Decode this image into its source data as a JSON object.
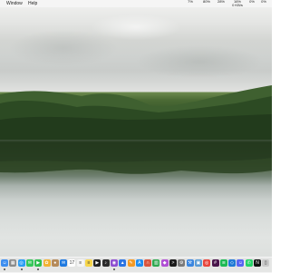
{
  "menubar": {
    "items": [
      "Window",
      "Help"
    ],
    "status": [
      {
        "top": "",
        "bottom": "7%"
      },
      {
        "top": "",
        "bottom": "80%"
      },
      {
        "top": "",
        "bottom": "28%"
      },
      {
        "top": "16%",
        "bottom": "0 KB/s"
      },
      {
        "top": "",
        "bottom": "0%"
      },
      {
        "top": "",
        "bottom": "0%"
      }
    ]
  },
  "desktop": {
    "wallpaper": "lake-reflection"
  },
  "dock": {
    "apps": [
      {
        "name": "finder-icon",
        "color": "#3d8ef0",
        "glyph": "☺"
      },
      {
        "name": "launchpad-icon",
        "color": "#8a8a8a",
        "glyph": "▦"
      },
      {
        "name": "safari-icon",
        "color": "#2a9df4",
        "glyph": "◎"
      },
      {
        "name": "messages-icon",
        "color": "#34c759",
        "glyph": "✉"
      },
      {
        "name": "facetime-icon",
        "color": "#2fbf4f",
        "glyph": "▶"
      },
      {
        "name": "photos-icon",
        "color": "#f2b233",
        "glyph": "✿"
      },
      {
        "name": "contacts-icon",
        "color": "#b58a5a",
        "glyph": "●"
      },
      {
        "name": "mail-icon",
        "color": "#1f7ae0",
        "glyph": "✉"
      },
      {
        "name": "calendar-icon",
        "color": "#ffffff",
        "glyph": "17"
      },
      {
        "name": "reminders-icon",
        "color": "#f5f5f5",
        "glyph": "≡"
      },
      {
        "name": "notes-icon",
        "color": "#f7d64a",
        "glyph": "≡"
      },
      {
        "name": "tv-icon",
        "color": "#222222",
        "glyph": "▶"
      },
      {
        "name": "music-icon",
        "color": "#2c2c2c",
        "glyph": "♪"
      },
      {
        "name": "podcasts-icon",
        "color": "#8e4fd1",
        "glyph": "◉"
      },
      {
        "name": "keynote-icon",
        "color": "#2b74e4",
        "glyph": "▲"
      },
      {
        "name": "pages-icon",
        "color": "#f59a23",
        "glyph": "✎"
      },
      {
        "name": "app-store-icon",
        "color": "#1f8ef1",
        "glyph": "A"
      },
      {
        "name": "headphones-icon",
        "color": "#d9553e",
        "glyph": "∩"
      },
      {
        "name": "numbers-icon",
        "color": "#2fa84f",
        "glyph": "▥"
      },
      {
        "name": "pixelmator-icon",
        "color": "#b04fd4",
        "glyph": "◆"
      },
      {
        "name": "terminal-icon",
        "color": "#1b1b1b",
        "glyph": ">"
      },
      {
        "name": "system-preferences-icon",
        "color": "#7a7a7a",
        "glyph": "⚙"
      },
      {
        "name": "xcode-icon",
        "color": "#3a86e0",
        "glyph": "⚒"
      },
      {
        "name": "preview-icon",
        "color": "#5a9bd5",
        "glyph": "▣"
      },
      {
        "name": "chrome-icon",
        "color": "#e8453c",
        "glyph": "◎"
      },
      {
        "name": "slack-icon",
        "color": "#4a154b",
        "glyph": "#"
      },
      {
        "name": "spotify-icon",
        "color": "#1db954",
        "glyph": "≋"
      },
      {
        "name": "vscode-icon",
        "color": "#1f7ad6",
        "glyph": "◇"
      },
      {
        "name": "discord-icon",
        "color": "#5865f2",
        "glyph": "☺"
      },
      {
        "name": "whatsapp-icon",
        "color": "#25d366",
        "glyph": "✆"
      },
      {
        "name": "netflix-icon",
        "color": "#111111",
        "glyph": "N"
      },
      {
        "name": "trash-icon",
        "color": "#c9c9c9",
        "glyph": "▯"
      }
    ]
  }
}
